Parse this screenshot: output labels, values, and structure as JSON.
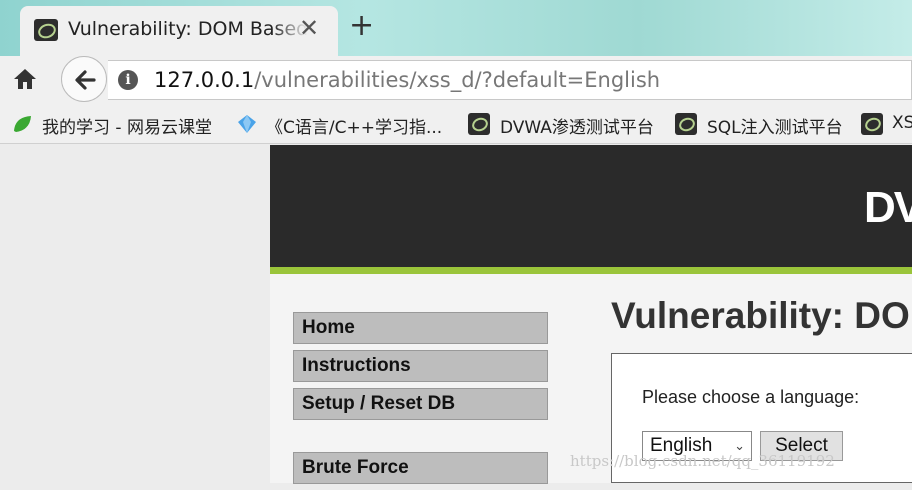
{
  "browser": {
    "tab_title": "Vulnerability: DOM Based",
    "close_glyph": "✕",
    "new_tab_glyph": "+",
    "url_host": "127.0.0.1",
    "url_path": "/vulnerabilities/xss_d/?default=English",
    "info_glyph": "i",
    "bookmarks": [
      {
        "label": "我的学习 - 网易云课堂",
        "icon": "green-leaf-icon"
      },
      {
        "label": "《C语言/C++学习指...",
        "icon": "blue-gem-icon"
      },
      {
        "label": "DVWA渗透测试平台",
        "icon": "dvwa-icon"
      },
      {
        "label": "SQL注入测试平台",
        "icon": "dvwa-icon"
      },
      {
        "label": "XS",
        "icon": "dvwa-icon"
      }
    ]
  },
  "dvwa": {
    "logo_text": "DV",
    "menu": [
      "Home",
      "Instructions",
      "Setup / Reset DB",
      "Brute Force"
    ],
    "page_title": "Vulnerability: DO",
    "prompt": "Please choose a language:",
    "language_selected": "English",
    "chevron": "⌄",
    "select_label": "Select"
  },
  "watermark": "https://blog.csdn.net/qq_36119192",
  "colors": {
    "accent_green": "#9ac43a",
    "header_dark": "#2a2a2a"
  }
}
